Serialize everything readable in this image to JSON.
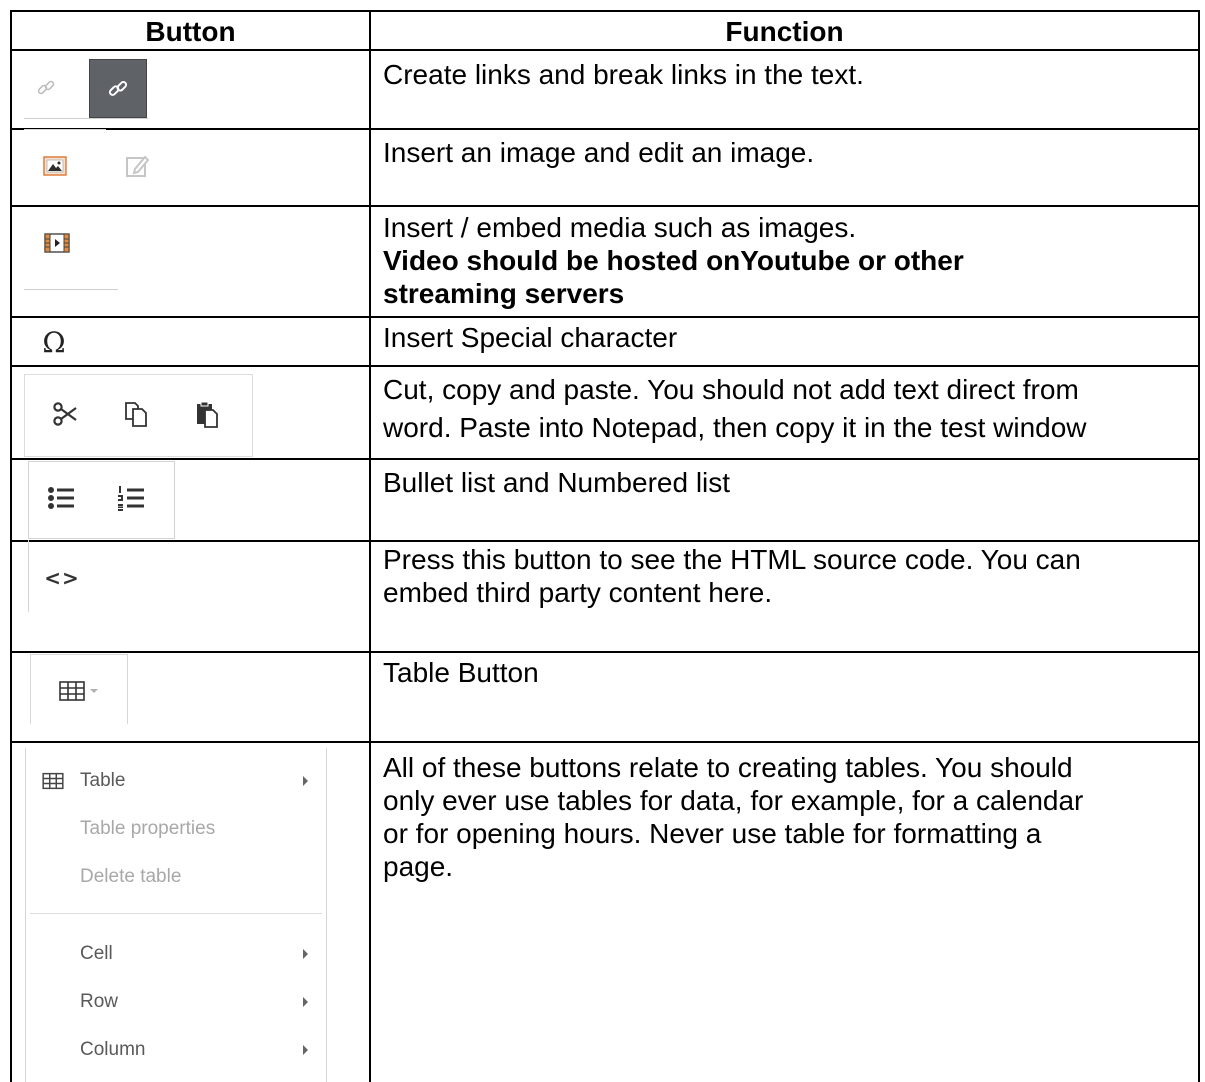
{
  "headers": {
    "button": "Button",
    "function": "Function"
  },
  "rows": [
    {
      "icons": [
        "unlink-icon",
        "link-icon"
      ],
      "lines": [
        "Create links and break links in the text."
      ]
    },
    {
      "icons": [
        "image-icon",
        "edit-image-icon"
      ],
      "lines": [
        "Insert an image and edit an image."
      ]
    },
    {
      "icons": [
        "media-icon"
      ],
      "lines": [
        "Insert / embed media such as images."
      ],
      "bold_lines": [
        "Video should be hosted onYoutube or other",
        "streaming servers"
      ]
    },
    {
      "icons": [
        "omega-icon"
      ],
      "glyph": "Ω",
      "lines": [
        "Insert Special character"
      ]
    },
    {
      "icons": [
        "cut-icon",
        "copy-icon",
        "paste-icon"
      ],
      "lines": [
        "Cut, copy and paste.  You should not add text direct from",
        "word.  Paste into Notepad, then copy it in the test window"
      ]
    },
    {
      "icons": [
        "bullet-list-icon",
        "numbered-list-icon"
      ],
      "lines": [
        "Bullet list and Numbered list"
      ]
    },
    {
      "icons": [
        "source-code-icon"
      ],
      "glyph": "<>",
      "lines": [
        "Press this button to see the HTML source code. You can",
        "embed third party content here."
      ]
    },
    {
      "icons": [
        "table-icon",
        "chevron-down-icon"
      ],
      "lines": [
        "Table Button"
      ]
    },
    {
      "lines": [
        "All of these buttons relate to creating tables. You should",
        "only ever use tables for data, for example, for a calendar",
        "or for opening hours. Never use table for formatting a",
        "page."
      ]
    }
  ],
  "table_menu": {
    "items": [
      {
        "label": "Table",
        "submenu": true,
        "enabled": true,
        "icon": "table-icon"
      },
      {
        "label": "Table properties",
        "submenu": false,
        "enabled": false
      },
      {
        "label": "Delete table",
        "submenu": false,
        "enabled": false
      },
      {
        "label": "Cell",
        "submenu": true,
        "enabled": true
      },
      {
        "label": "Row",
        "submenu": true,
        "enabled": true
      },
      {
        "label": "Column",
        "submenu": true,
        "enabled": true
      }
    ]
  },
  "colors": {
    "border": "#000000",
    "icon_gray": "#b8b8b8",
    "active_button": "#5f6368"
  }
}
